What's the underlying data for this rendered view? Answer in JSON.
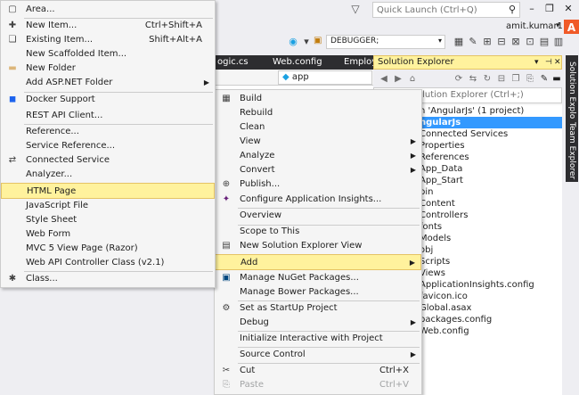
{
  "topbar": {
    "quick_launch_placeholder": "Quick Launch (Ctrl+Q)",
    "user_name": "amit.kumar1",
    "alert_badge": "A"
  },
  "toolbar": {
    "debug_config": "DEBUGGER;"
  },
  "doc_tabs": [
    {
      "label": "ogic.cs"
    },
    {
      "label": "Web.config"
    },
    {
      "label": "Employe"
    }
  ],
  "editor": {
    "scope_combo": "app"
  },
  "solution_explorer": {
    "title": "Solution Explorer",
    "search_text": "olution Explorer (Ctrl+;)",
    "items": [
      {
        "label": "n 'AngularJs' (1 project)"
      },
      {
        "label": "ngularJs"
      },
      {
        "label": "Connected Services"
      },
      {
        "label": "Properties"
      },
      {
        "label": "References"
      },
      {
        "label": "App_Data"
      },
      {
        "label": "App_Start"
      },
      {
        "label": "bin"
      },
      {
        "label": "Content"
      },
      {
        "label": "Controllers"
      },
      {
        "label": "fonts"
      },
      {
        "label": "Models"
      },
      {
        "label": "obj"
      },
      {
        "label": "Scripts"
      },
      {
        "label": "Views"
      },
      {
        "label": "ApplicationInsights.config"
      },
      {
        "label": "favicon.ico"
      },
      {
        "label": "Global.asax"
      },
      {
        "label": "packages.config"
      },
      {
        "label": "Web.config"
      }
    ]
  },
  "rail": {
    "tab1": "Solution Explorer",
    "tab2": "Team Explorer"
  },
  "add_menu": {
    "items": [
      {
        "label": "Area...",
        "shortcut": "",
        "icon": "area-icon"
      },
      {
        "label": "New Item...",
        "shortcut": "Ctrl+Shift+A",
        "icon": "new-item-icon"
      },
      {
        "label": "Existing Item...",
        "shortcut": "Shift+Alt+A",
        "icon": "existing-item-icon"
      },
      {
        "label": "New Scaffolded Item...",
        "shortcut": "",
        "icon": ""
      },
      {
        "label": "New Folder",
        "shortcut": "",
        "icon": "new-folder-icon"
      },
      {
        "label": "Add ASP.NET Folder",
        "shortcut": "",
        "icon": ""
      },
      {
        "label": "Docker Support",
        "shortcut": "",
        "icon": "docker-icon"
      },
      {
        "label": "REST API Client...",
        "shortcut": "",
        "icon": ""
      },
      {
        "label": "Reference...",
        "shortcut": "",
        "icon": ""
      },
      {
        "label": "Service Reference...",
        "shortcut": "",
        "icon": ""
      },
      {
        "label": "Connected Service",
        "shortcut": "",
        "icon": "connected-service-icon"
      },
      {
        "label": "Analyzer...",
        "shortcut": "",
        "icon": ""
      },
      {
        "label": "HTML Page",
        "shortcut": "",
        "icon": ""
      },
      {
        "label": "JavaScript File",
        "shortcut": "",
        "icon": ""
      },
      {
        "label": "Style Sheet",
        "shortcut": "",
        "icon": ""
      },
      {
        "label": "Web Form",
        "shortcut": "",
        "icon": ""
      },
      {
        "label": "MVC 5 View Page (Razor)",
        "shortcut": "",
        "icon": ""
      },
      {
        "label": "Web API Controller Class (v2.1)",
        "shortcut": "",
        "icon": ""
      },
      {
        "label": "Class...",
        "shortcut": "",
        "icon": "class-icon"
      }
    ]
  },
  "context_menu": {
    "items": [
      {
        "label": "Build",
        "shortcut": ""
      },
      {
        "label": "Rebuild",
        "shortcut": ""
      },
      {
        "label": "Clean",
        "shortcut": ""
      },
      {
        "label": "View",
        "shortcut": ""
      },
      {
        "label": "Analyze",
        "shortcut": ""
      },
      {
        "label": "Convert",
        "shortcut": ""
      },
      {
        "label": "Publish...",
        "shortcut": ""
      },
      {
        "label": "Configure Application Insights...",
        "shortcut": ""
      },
      {
        "label": "Overview",
        "shortcut": ""
      },
      {
        "label": "Scope to This",
        "shortcut": ""
      },
      {
        "label": "New Solution Explorer View",
        "shortcut": ""
      },
      {
        "label": "Add",
        "shortcut": ""
      },
      {
        "label": "Manage NuGet Packages...",
        "shortcut": ""
      },
      {
        "label": "Manage Bower Packages...",
        "shortcut": ""
      },
      {
        "label": "Set as StartUp Project",
        "shortcut": ""
      },
      {
        "label": "Debug",
        "shortcut": ""
      },
      {
        "label": "Initialize Interactive with Project",
        "shortcut": ""
      },
      {
        "label": "Source Control",
        "shortcut": ""
      },
      {
        "label": "Cut",
        "shortcut": "Ctrl+X"
      },
      {
        "label": "Paste",
        "shortcut": "Ctrl+V"
      }
    ]
  },
  "colors": {
    "highlight": "#fff29d",
    "highlight_border": "#e5c365",
    "selection": "#3399ff",
    "accent_badge": "#f05a28",
    "dark_tabs": "#2d2d30"
  }
}
